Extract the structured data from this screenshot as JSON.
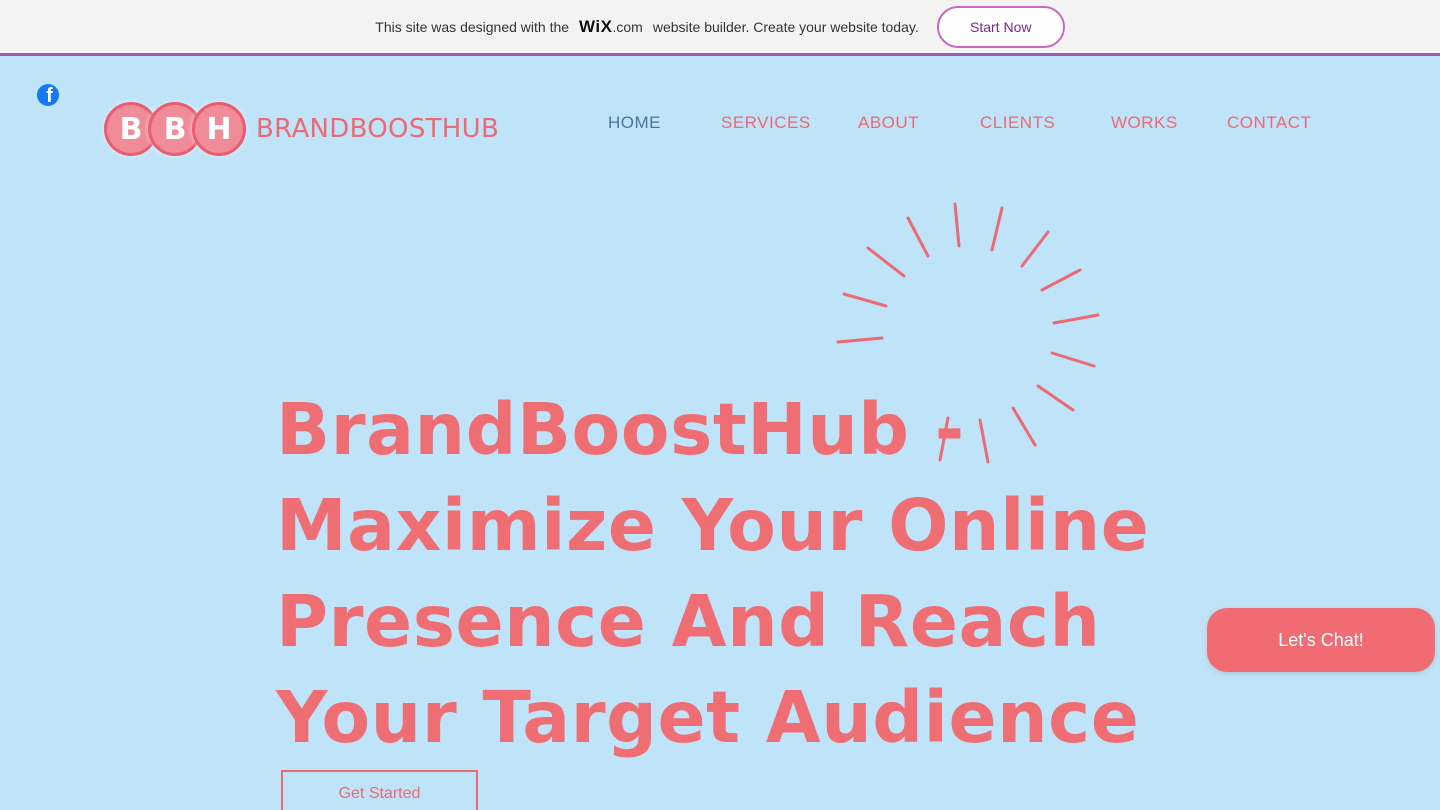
{
  "banner": {
    "text_before": "This site was designed with the",
    "wix_logo": "WiX",
    "wix_suffix": ".com",
    "text_after": "website builder. Create your website today.",
    "start_label": "Start Now"
  },
  "social": {
    "facebook_icon": "facebook-icon"
  },
  "logo": {
    "letters": [
      "B",
      "B",
      "H"
    ],
    "name": "BRANDBOOSTHUB"
  },
  "nav": {
    "items": [
      {
        "label": "HOME",
        "active": true
      },
      {
        "label": "SERVICES",
        "active": false
      },
      {
        "label": "ABOUT",
        "active": false
      },
      {
        "label": "CLIENTS",
        "active": false
      },
      {
        "label": "WORKS",
        "active": false
      },
      {
        "label": "CONTACT",
        "active": false
      }
    ]
  },
  "hero": {
    "line1": "BrandBoostHub -",
    "line2": "Maximize Your Online",
    "line3": "Presence And Reach",
    "line4": "Your Target Audience",
    "cta_label": "Get Started"
  },
  "chat": {
    "label": "Let's Chat!"
  },
  "colors": {
    "background": "#bfe3f8",
    "accent": "#ec6a73",
    "nav_active": "#4b74a0",
    "facebook": "#1877f2"
  }
}
